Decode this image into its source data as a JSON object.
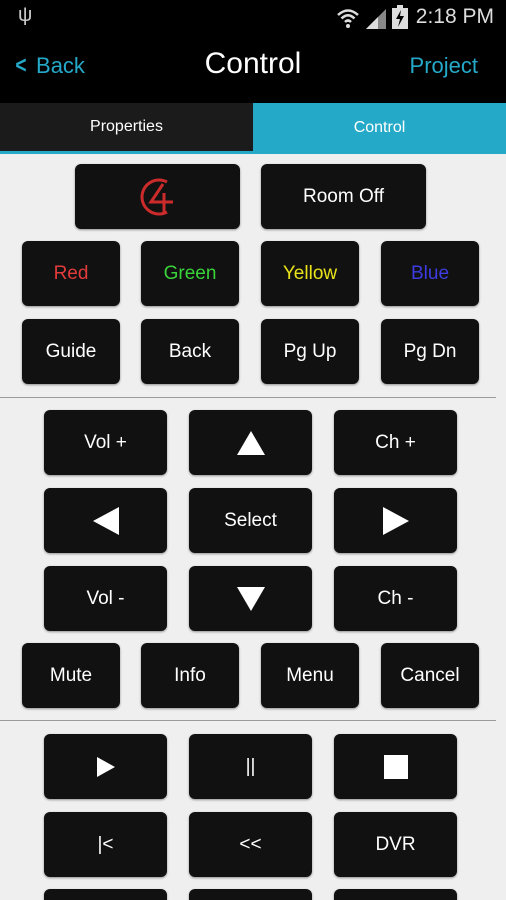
{
  "status_bar": {
    "time": "2:18 PM",
    "usb_icon": "usb-icon",
    "wifi_icon": "wifi-icon",
    "signal_icon": "signal-icon",
    "battery_icon": "battery-charging-icon"
  },
  "action_bar": {
    "back_label": "Back",
    "title": "Control",
    "project_label": "Project",
    "accent": "#25a9c8"
  },
  "tabs": [
    {
      "label": "Properties",
      "active": false
    },
    {
      "label": "Control",
      "active": true
    }
  ],
  "buttons": {
    "logo_icon": "control4-logo-icon",
    "room_off": "Room Off",
    "red": "Red",
    "green": "Green",
    "yellow": "Yellow",
    "blue": "Blue",
    "guide": "Guide",
    "back": "Back",
    "pg_up": "Pg Up",
    "pg_dn": "Pg Dn",
    "vol_up": "Vol +",
    "ch_up": "Ch +",
    "select": "Select",
    "vol_down": "Vol -",
    "ch_down": "Ch -",
    "mute": "Mute",
    "info": "Info",
    "menu": "Menu",
    "cancel": "Cancel",
    "pause": "||",
    "skip_back": "|<",
    "rewind": "<<",
    "dvr": "DVR"
  },
  "colors": {
    "red": "#e23b3b",
    "green": "#39d33a",
    "yellow": "#e8e21a",
    "blue": "#3c3ce0",
    "logo": "#cc2b2b"
  }
}
